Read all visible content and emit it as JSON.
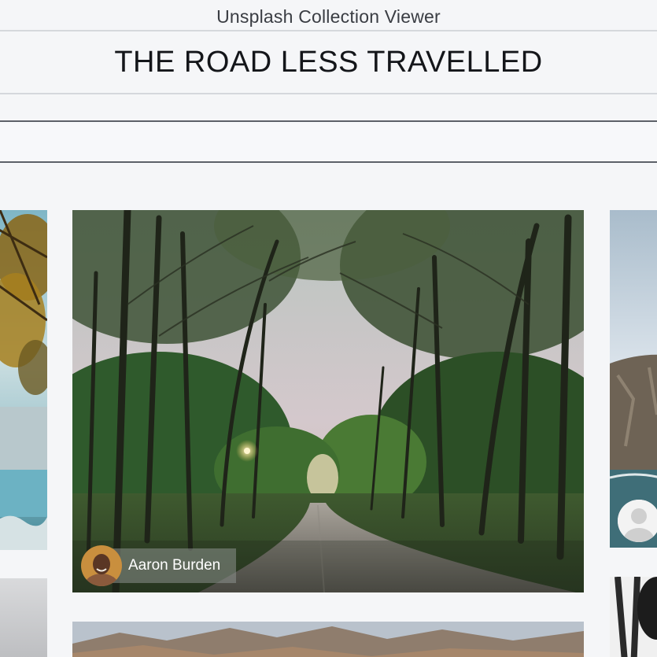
{
  "app": {
    "title": "Unsplash Collection Viewer"
  },
  "collection": {
    "title": "THE ROAD LESS TRAVELLED"
  },
  "photos": {
    "main": {
      "author": "Aaron Burden"
    }
  },
  "colors": {
    "background": "#f5f6f8",
    "rule_light": "#d5d8dc",
    "rule_dark": "#5d6168",
    "author_pill": "#8c928e"
  }
}
